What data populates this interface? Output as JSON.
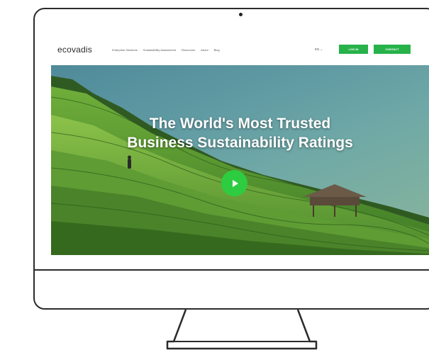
{
  "site": {
    "logo_text": "ecovadis",
    "nav_items": [
      "Enterprise Solutions",
      "Sustainability Assessment",
      "Resources",
      "About",
      "Blog"
    ],
    "language": "EN ⌄",
    "login_label": "LOG IN",
    "contact_label": "CONTACT"
  },
  "hero": {
    "title_line1": "The World's Most Trusted",
    "title_line2": "Business Sustainability Ratings"
  },
  "colors": {
    "brand_green": "#27b24a",
    "play_green": "#2ecc40",
    "frame": "#2b2b2b"
  }
}
